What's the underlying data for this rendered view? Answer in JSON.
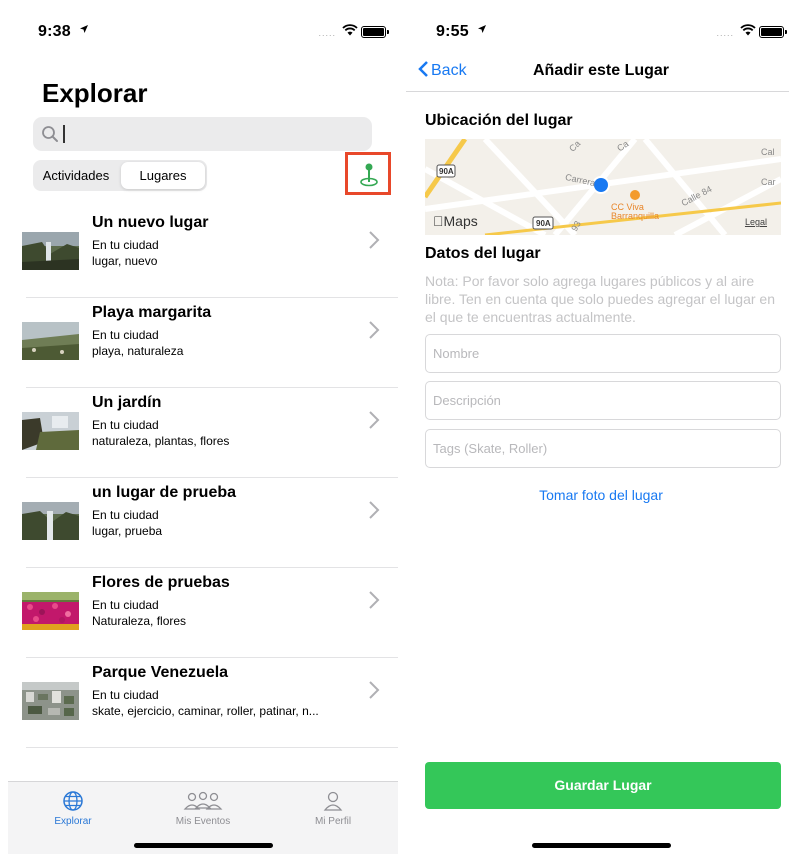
{
  "left": {
    "status": {
      "time": "9:38",
      "signal": "....."
    },
    "title": "Explorar",
    "search": {
      "placeholder": ""
    },
    "segments": [
      "Actividades",
      "Lugares"
    ],
    "segment_selected": "Lugares",
    "places": [
      {
        "name": "Un nuevo lugar",
        "location": "En tu ciudad",
        "tags": "lugar, nuevo",
        "thumb": "waterfall"
      },
      {
        "name": "Playa margarita",
        "location": "En tu ciudad",
        "tags": "playa, naturaleza",
        "thumb": "coast"
      },
      {
        "name": "Un jardín",
        "location": "En tu ciudad",
        "tags": "naturaleza, plantas, flores",
        "thumb": "cliff"
      },
      {
        "name": "un lugar de prueba",
        "location": "En tu ciudad",
        "tags": "lugar, prueba",
        "thumb": "waterfall"
      },
      {
        "name": "Flores de pruebas",
        "location": "En tu ciudad",
        "tags": "Naturaleza, flores",
        "thumb": "flowers"
      },
      {
        "name": "Parque Venezuela",
        "location": "En tu ciudad",
        "tags": "skate, ejercicio, caminar, roller, patinar, n...",
        "thumb": "city"
      }
    ],
    "tabs": [
      {
        "label": "Explorar",
        "icon": "globe-icon",
        "active": true
      },
      {
        "label": "Mis Eventos",
        "icon": "people-icon",
        "active": false
      },
      {
        "label": "Mi Perfil",
        "icon": "person-icon",
        "active": false
      }
    ],
    "colors": {
      "accent": "#2a78d6",
      "pin": "#34a853",
      "highlight": "#e8482a"
    }
  },
  "right": {
    "status": {
      "time": "9:55",
      "signal": "....."
    },
    "nav": {
      "back": "Back",
      "title": "Añadir este Lugar"
    },
    "location_heading": "Ubicación del lugar",
    "map": {
      "brand": "Maps",
      "legal": "Legal",
      "streets": [
        "Carrera",
        "Calle 84",
        "Ca",
        "Car",
        "Cal",
        "Ca"
      ],
      "route_shields": [
        "90A",
        "90A"
      ],
      "route_numbers": [
        "93"
      ],
      "poi": "CC Viva\nBarranquilla"
    },
    "details_heading": "Datos del lugar",
    "note": "Nota: Por favor solo agrega lugares públicos y al aire libre. Ten en cuenta que solo puedes agregar el lugar en el que te encuentras actualmente.",
    "fields": {
      "name_placeholder": "Nombre",
      "description_placeholder": "Descripción",
      "tags_placeholder": "Tags (Skate, Roller)"
    },
    "photo_link": "Tomar foto del lugar",
    "save_button": "Guardar Lugar",
    "colors": {
      "link": "#1879f2",
      "save": "#34c759",
      "location_dot": "#1879f2"
    }
  }
}
